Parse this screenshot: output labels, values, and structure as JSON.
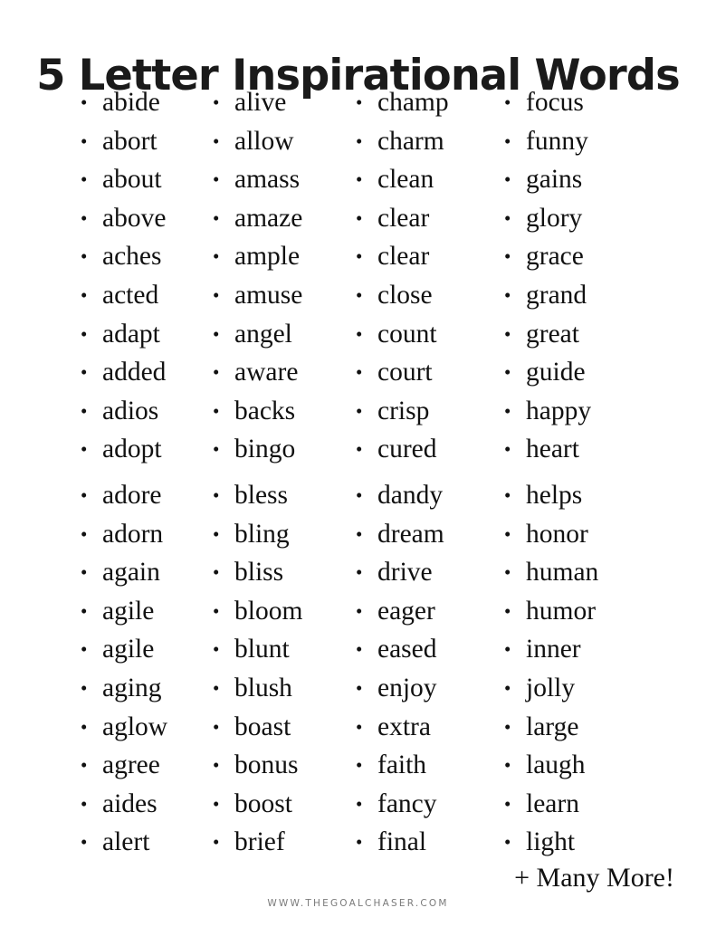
{
  "document": {
    "title": "5 Letter Inspirational Words",
    "background_color": "#ffffff",
    "text_color": "#111111",
    "footer_color": "#7a7a7a"
  },
  "columns": [
    {
      "id": "column-1",
      "top": [
        "abide",
        "abort",
        "about",
        "above",
        "aches",
        "acted",
        "adapt",
        "added",
        "adios",
        "adopt"
      ],
      "bottom": [
        "adore",
        "adorn",
        "again",
        "agile",
        "agile",
        "aging",
        "aglow",
        "agree",
        "aides",
        "alert"
      ]
    },
    {
      "id": "column-2",
      "top": [
        "alive",
        "allow",
        "amass",
        "amaze",
        "ample",
        "amuse",
        "angel",
        "aware",
        "backs",
        "bingo"
      ],
      "bottom": [
        "bless",
        "bling",
        "bliss",
        "bloom",
        "blunt",
        "blush",
        "boast",
        "bonus",
        "boost",
        "brief"
      ]
    },
    {
      "id": "column-3",
      "top": [
        "champ",
        "charm",
        "clean",
        "clear",
        "clear",
        "close",
        "count",
        "court",
        "crisp",
        "cured"
      ],
      "bottom": [
        "dandy",
        "dream",
        "drive",
        "eager",
        "eased",
        "enjoy",
        "extra",
        "faith",
        "fancy",
        "final"
      ]
    },
    {
      "id": "column-4",
      "top": [
        "focus",
        "funny",
        "gains",
        "glory",
        "grace",
        "grand",
        "great",
        "guide",
        "happy",
        "heart"
      ],
      "bottom": [
        "helps",
        "honor",
        "human",
        "humor",
        "inner",
        "jolly",
        "large",
        "laugh",
        "learn",
        "light"
      ]
    }
  ],
  "many_more": "+ Many More!",
  "footer": {
    "url": "WWW.THEGOALCHASER.COM"
  }
}
